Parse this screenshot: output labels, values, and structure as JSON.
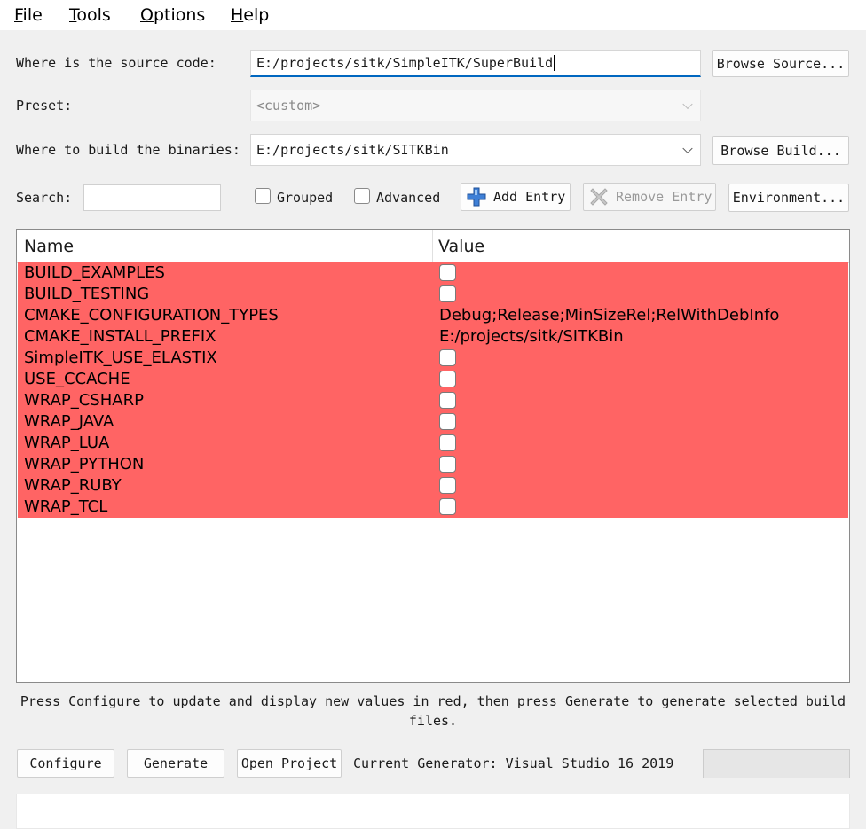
{
  "menu": {
    "file": {
      "first": "F",
      "rest": "ile"
    },
    "tools": {
      "first": "T",
      "rest": "ools"
    },
    "options": {
      "first": "O",
      "rest": "ptions"
    },
    "help": {
      "first": "H",
      "rest": "elp"
    }
  },
  "source": {
    "label": "Where is the source code:",
    "value": "E:/projects/sitk/SimpleITK/SuperBuild",
    "browse_label": "Browse Source..."
  },
  "preset": {
    "label": "Preset:",
    "value": "<custom>"
  },
  "build": {
    "label": "Where to build the binaries:",
    "value": "E:/projects/sitk/SITKBin",
    "browse_label": "Browse Build..."
  },
  "toolbar": {
    "search_label": "Search:",
    "search_value": "",
    "grouped_label": "Grouped",
    "grouped_checked": false,
    "advanced_label": "Advanced",
    "advanced_checked": false,
    "add_entry_label": "Add Entry",
    "remove_entry_label": "Remove Entry",
    "environment_label": "Environment..."
  },
  "table": {
    "headers": {
      "name": "Name",
      "value": "Value"
    },
    "highlight_color": "#ff6464",
    "rows": [
      {
        "name": "BUILD_EXAMPLES",
        "type": "bool",
        "checked": false
      },
      {
        "name": "BUILD_TESTING",
        "type": "bool",
        "checked": false
      },
      {
        "name": "CMAKE_CONFIGURATION_TYPES",
        "type": "string",
        "value": "Debug;Release;MinSizeRel;RelWithDebInfo"
      },
      {
        "name": "CMAKE_INSTALL_PREFIX",
        "type": "string",
        "value": "E:/projects/sitk/SITKBin"
      },
      {
        "name": "SimpleITK_USE_ELASTIX",
        "type": "bool",
        "checked": false
      },
      {
        "name": "USE_CCACHE",
        "type": "bool",
        "checked": false
      },
      {
        "name": "WRAP_CSHARP",
        "type": "bool",
        "checked": false
      },
      {
        "name": "WRAP_JAVA",
        "type": "bool",
        "checked": false
      },
      {
        "name": "WRAP_LUA",
        "type": "bool",
        "checked": false
      },
      {
        "name": "WRAP_PYTHON",
        "type": "bool",
        "checked": false
      },
      {
        "name": "WRAP_RUBY",
        "type": "bool",
        "checked": false
      },
      {
        "name": "WRAP_TCL",
        "type": "bool",
        "checked": false
      }
    ]
  },
  "hint_text": "Press Configure to update and display new values in red, then press Generate to generate selected build files.",
  "bottom": {
    "configure_label": "Configure",
    "generate_label": "Generate",
    "open_project_label": "Open Project",
    "generator_text": "Current Generator: Visual Studio 16 2019"
  }
}
